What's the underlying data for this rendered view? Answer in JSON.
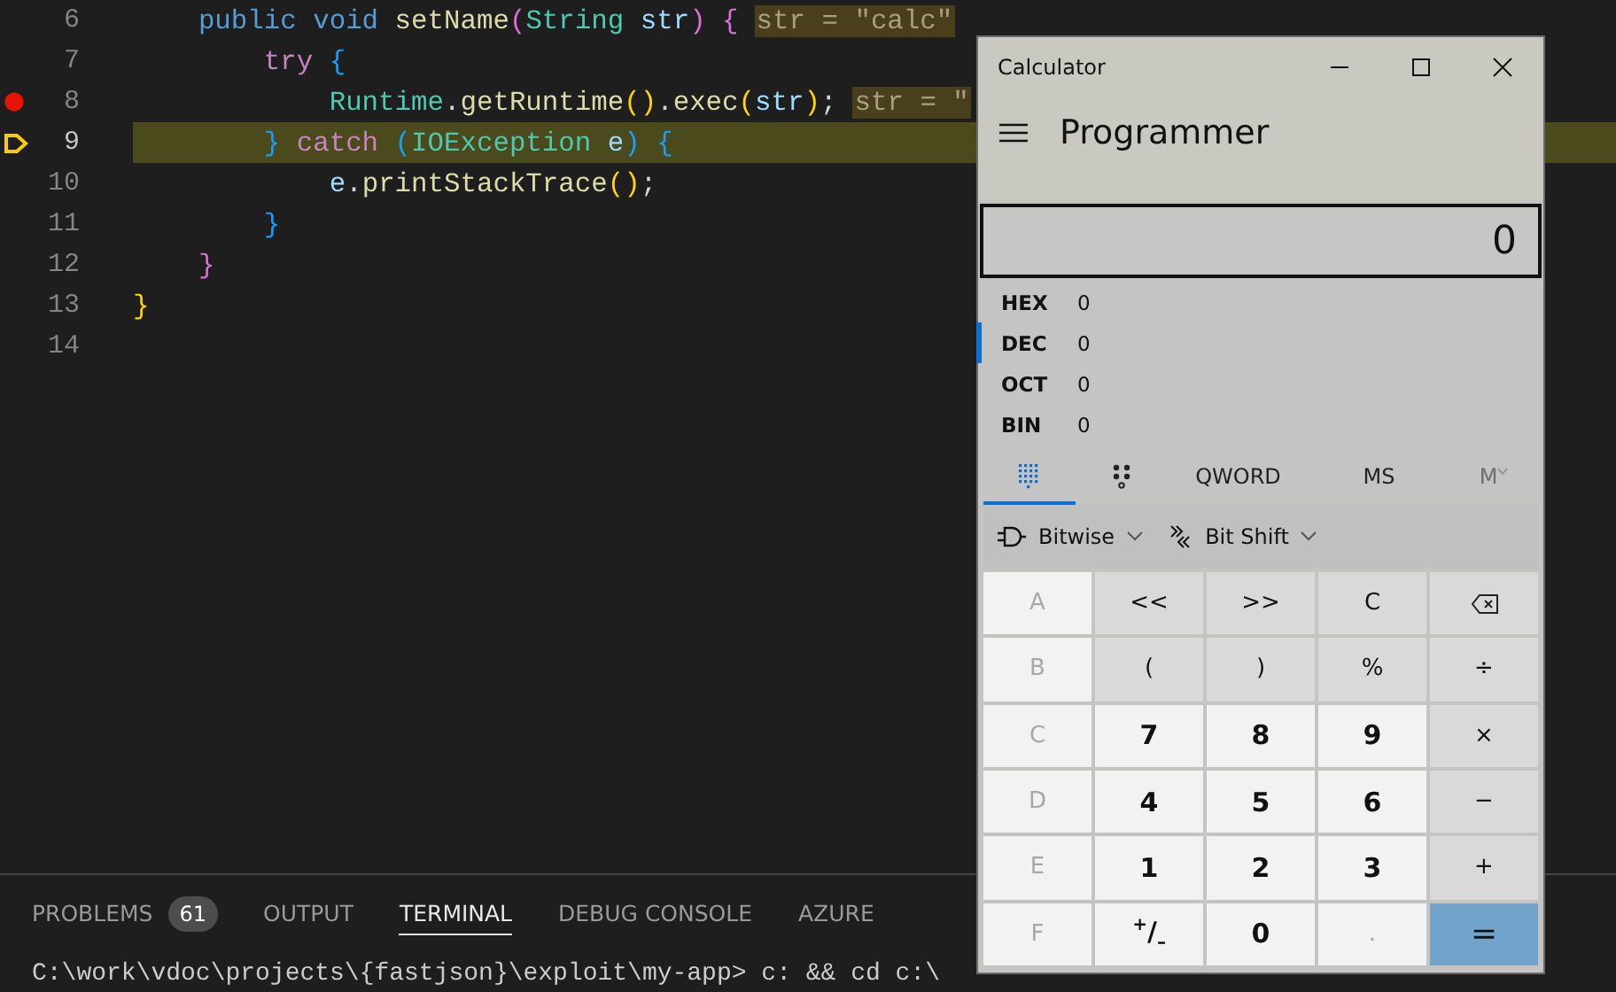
{
  "editor": {
    "lines": [
      {
        "number": "6",
        "breakpoint": false,
        "current": false,
        "tokens": [
          {
            "text": "    public",
            "kind": "keyword"
          },
          {
            "text": " void",
            "kind": "keyword"
          },
          {
            "text": " setName",
            "kind": "function"
          },
          {
            "text": "(",
            "kind": "bracket2"
          },
          {
            "text": "String",
            "kind": "type"
          },
          {
            "text": " str",
            "kind": "variable"
          },
          {
            "text": ")",
            "kind": "bracket2"
          },
          {
            "text": " {",
            "kind": "bracket2"
          }
        ],
        "hint": "str = \"calc\""
      },
      {
        "number": "7",
        "breakpoint": false,
        "current": false,
        "tokens": [
          {
            "text": "        try",
            "kind": "control"
          },
          {
            "text": " {",
            "kind": "bracket3"
          }
        ]
      },
      {
        "number": "8",
        "breakpoint": true,
        "current": false,
        "tokens": [
          {
            "text": "            Runtime",
            "kind": "type"
          },
          {
            "text": ".",
            "kind": "plain"
          },
          {
            "text": "getRuntime",
            "kind": "function"
          },
          {
            "text": "()",
            "kind": "bracket1"
          },
          {
            "text": ".",
            "kind": "plain"
          },
          {
            "text": "exec",
            "kind": "function"
          },
          {
            "text": "(",
            "kind": "bracket1"
          },
          {
            "text": "str",
            "kind": "variable"
          },
          {
            "text": ")",
            "kind": "bracket1"
          },
          {
            "text": ";",
            "kind": "plain"
          }
        ],
        "hint": "str = \""
      },
      {
        "number": "9",
        "breakpoint": false,
        "current": true,
        "tokens": [
          {
            "text": "        }",
            "kind": "bracket3"
          },
          {
            "text": " catch",
            "kind": "control"
          },
          {
            "text": " (",
            "kind": "bracket3"
          },
          {
            "text": "IOException",
            "kind": "type"
          },
          {
            "text": " e",
            "kind": "variable"
          },
          {
            "text": ")",
            "kind": "bracket3"
          },
          {
            "text": " {",
            "kind": "bracket3"
          }
        ]
      },
      {
        "number": "10",
        "breakpoint": false,
        "current": false,
        "tokens": [
          {
            "text": "            e",
            "kind": "variable"
          },
          {
            "text": ".",
            "kind": "plain"
          },
          {
            "text": "printStackTrace",
            "kind": "function"
          },
          {
            "text": "()",
            "kind": "bracket1"
          },
          {
            "text": ";",
            "kind": "plain"
          }
        ]
      },
      {
        "number": "11",
        "breakpoint": false,
        "current": false,
        "tokens": [
          {
            "text": "        }",
            "kind": "bracket3"
          }
        ]
      },
      {
        "number": "12",
        "breakpoint": false,
        "current": false,
        "tokens": [
          {
            "text": "    }",
            "kind": "bracket2"
          }
        ]
      },
      {
        "number": "13",
        "breakpoint": false,
        "current": false,
        "tokens": [
          {
            "text": "}",
            "kind": "bracket1"
          }
        ]
      },
      {
        "number": "14",
        "breakpoint": false,
        "current": false
      }
    ]
  },
  "panel": {
    "tabs": [
      {
        "label": "PROBLEMS",
        "badge": "61",
        "selected": false
      },
      {
        "label": "OUTPUT",
        "selected": false
      },
      {
        "label": "TERMINAL",
        "selected": true
      },
      {
        "label": "DEBUG CONSOLE",
        "selected": false
      },
      {
        "label": "AZURE",
        "selected": false
      }
    ],
    "terminal_line": "C:\\work\\vdoc\\projects\\{fastjson}\\exploit\\my-app> c: && cd c:\\"
  },
  "calculator": {
    "title": "Calculator",
    "mode": "Programmer",
    "display": "0",
    "radix": [
      {
        "label": "HEX",
        "value": "0",
        "selected": false
      },
      {
        "label": "DEC",
        "value": "0",
        "selected": true
      },
      {
        "label": "OCT",
        "value": "0",
        "selected": false
      },
      {
        "label": "BIN",
        "value": "0",
        "selected": false
      }
    ],
    "tabs": [
      {
        "kind": "keypad",
        "selected": true
      },
      {
        "kind": "bits",
        "selected": false
      },
      {
        "kind": "text",
        "label": "QWORD",
        "selected": false
      },
      {
        "kind": "text",
        "label": "MS",
        "selected": false
      },
      {
        "kind": "memory",
        "label": "M",
        "selected": false,
        "disabled": true
      }
    ],
    "dropdowns": [
      {
        "kind": "bitwise",
        "label": "Bitwise"
      },
      {
        "kind": "bitshift",
        "label": "Bit Shift"
      }
    ],
    "keys": [
      {
        "label": "A",
        "kind": "digit",
        "disabled": true
      },
      {
        "label": "<<",
        "kind": "operator",
        "disabled": false
      },
      {
        "label": ">>",
        "kind": "operator",
        "disabled": false
      },
      {
        "label": "C",
        "kind": "operator",
        "disabled": false
      },
      {
        "kind": "backspace",
        "disabled": false
      },
      {
        "label": "B",
        "kind": "digit",
        "disabled": true
      },
      {
        "label": "(",
        "kind": "operator",
        "disabled": false
      },
      {
        "label": ")",
        "kind": "operator",
        "disabled": false
      },
      {
        "label": "%",
        "kind": "operator",
        "disabled": false
      },
      {
        "label": "÷",
        "kind": "operator",
        "disabled": false
      },
      {
        "label": "C",
        "kind": "digit",
        "disabled": true
      },
      {
        "label": "7",
        "kind": "digit",
        "disabled": false
      },
      {
        "label": "8",
        "kind": "digit",
        "disabled": false
      },
      {
        "label": "9",
        "kind": "digit",
        "disabled": false
      },
      {
        "label": "×",
        "kind": "operator",
        "disabled": false
      },
      {
        "label": "D",
        "kind": "digit",
        "disabled": true
      },
      {
        "label": "4",
        "kind": "digit",
        "disabled": false
      },
      {
        "label": "5",
        "kind": "digit",
        "disabled": false
      },
      {
        "label": "6",
        "kind": "digit",
        "disabled": false
      },
      {
        "label": "−",
        "kind": "operator",
        "disabled": false
      },
      {
        "label": "E",
        "kind": "digit",
        "disabled": true
      },
      {
        "label": "1",
        "kind": "digit",
        "disabled": false
      },
      {
        "label": "2",
        "kind": "digit",
        "disabled": false
      },
      {
        "label": "3",
        "kind": "digit",
        "disabled": false
      },
      {
        "label": "+",
        "kind": "operator",
        "disabled": false
      },
      {
        "label": "F",
        "kind": "digit",
        "disabled": true
      },
      {
        "label": "$^{+}$/$_{–}$",
        "kind": "digit",
        "disabled": false
      },
      {
        "label": "0",
        "kind": "digit",
        "disabled": false
      },
      {
        "label": ".",
        "kind": "digit",
        "disabled": true
      },
      {
        "label": "=",
        "kind": "equals",
        "disabled": false
      }
    ]
  }
}
